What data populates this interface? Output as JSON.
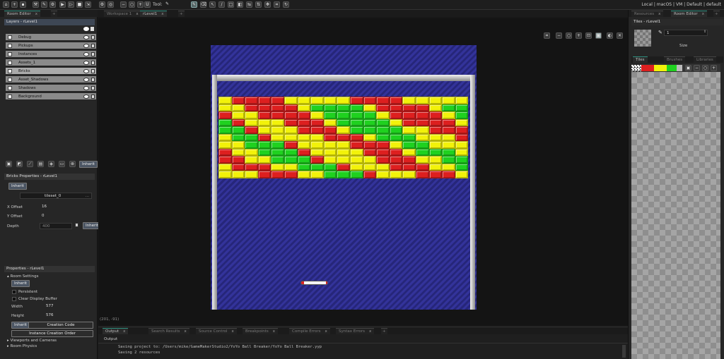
{
  "toolbar": {
    "tool_label": "Tool:",
    "target": [
      "Local",
      "macOS",
      "VM",
      "Default",
      "default"
    ]
  },
  "left": {
    "tabs": [
      {
        "label": "Room Editor"
      }
    ],
    "layers_header": "Layers - rLevel1",
    "layers": [
      {
        "label": "Debug"
      },
      {
        "label": "Pickups"
      },
      {
        "label": "Instances"
      },
      {
        "label": "Assets_1"
      },
      {
        "label": "Bricks"
      },
      {
        "label": "Asset_Shadows"
      },
      {
        "label": "Shadows"
      },
      {
        "label": "Background"
      }
    ],
    "inherit_label": "Inherit",
    "bricks_props": {
      "header": "Bricks Properties - rLevel1",
      "inherit": "Inherit",
      "tileset": "tileset_0",
      "x_offset_label": "X Offset",
      "x_offset": "16",
      "y_offset_label": "Y Offset",
      "y_offset": "0",
      "depth_label": "Depth",
      "depth": "400",
      "depth_inherit": "Inherit"
    },
    "room_props": {
      "header": "Properties - rLevel1",
      "room_settings": "Room Settings",
      "inherit": "Inherit",
      "persistent": "Persistent",
      "clear_display": "Clear Display Buffer",
      "width_label": "Width",
      "width": "577",
      "height_label": "Height",
      "height": "576",
      "inherit2": "Inherit",
      "creation_code": "Creation Code",
      "instance_order": "Instance Creation Order",
      "viewports": "Viewports and Cameras",
      "physics": "Room Physics"
    }
  },
  "center": {
    "tabs": [
      {
        "label": "Workspace 1"
      },
      {
        "label": "rLevel1"
      }
    ],
    "coords": "(201, -91)",
    "output_tabs": [
      {
        "label": "Output"
      },
      {
        "label": "Search Results"
      },
      {
        "label": "Source Control"
      },
      {
        "label": "Breakpoints"
      },
      {
        "label": "Compile Errors"
      },
      {
        "label": "Syntax Errors"
      }
    ],
    "output_title": "Output",
    "output_lines": [
      "Saving project to: /Users/mike/GameMakerStudio2/YoYo Ball Breaker/YoYo Ball Breaker.yyp",
      "Saving 2 resources"
    ],
    "brick_colors": {
      "red": "#dd1f1f",
      "yellow": "#f2f20a",
      "green": "#1fd11f"
    },
    "brick_rows": [
      "YRRRRYYYYYRRRRYYYYY",
      "YYRRRRYGGGGYRRRRYGG",
      "RYYRRRRYGGGGYRRRRYG",
      "GRYYYRRRYGGGGYRRRRY",
      "GGRYYYRRRYGGGGYYRRR",
      "YGGRYYYYRRRYGGGYYYR",
      "YYGGGRYYYYRRRYGGYYY",
      "RYYGGGRYYYYRRRYGGGY",
      "RRYYGGGRYYYYRRRYYGG",
      "YRRRYYGGGRYYYRRRYYG",
      "YYYRRRYYGGGRYYYRRRY"
    ]
  },
  "right": {
    "tabs": [
      {
        "label": "Resources"
      },
      {
        "label": "Room Editor"
      }
    ],
    "tiles_header": "Tiles - rLevel1",
    "size_value": "1",
    "size_label": "Size",
    "sub_tabs": [
      {
        "label": "Tiles"
      },
      {
        "label": "Brushes"
      },
      {
        "label": "Libraries"
      }
    ]
  }
}
